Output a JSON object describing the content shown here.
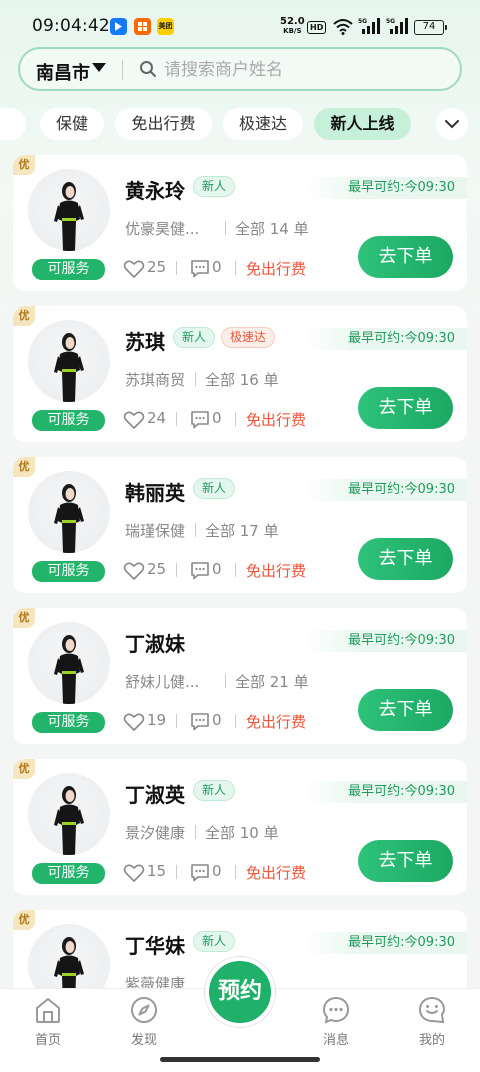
{
  "status_bar": {
    "time": "09:04:42",
    "app_icons": [
      "alipay-icon",
      "app-icon",
      "meituan-icon"
    ],
    "app_icon_texts": [
      "",
      "",
      "美团"
    ],
    "net_speed": "52.0",
    "net_unit": "KB/S",
    "hd": "HD",
    "battery": "74"
  },
  "search": {
    "city": "南昌市",
    "placeholder": "请搜索商户姓名"
  },
  "tabs": [
    {
      "label": "保健",
      "active": false
    },
    {
      "label": "免出行费",
      "active": false
    },
    {
      "label": "极速达",
      "active": false
    },
    {
      "label": "新人上线",
      "active": true
    }
  ],
  "card_common": {
    "badge": "优",
    "status": "可服务",
    "free_label": "免出行费",
    "order_button": "去下单"
  },
  "cards": [
    {
      "name": "黄永玲",
      "tags": [
        "新人"
      ],
      "earliest": "最早可约:今09:30",
      "shop": "优豪昊健...",
      "orders": "全部 14 单",
      "likes": "25",
      "messages": "0"
    },
    {
      "name": "苏琪",
      "tags": [
        "新人",
        "极速达"
      ],
      "earliest": "最早可约:今09:30",
      "shop": "苏琪商贸",
      "orders": "全部 16 单",
      "likes": "24",
      "messages": "0"
    },
    {
      "name": "韩丽英",
      "tags": [
        "新人"
      ],
      "earliest": "最早可约:今09:30",
      "shop": "瑞瑾保健",
      "orders": "全部 17 单",
      "likes": "25",
      "messages": "0"
    },
    {
      "name": "丁淑妹",
      "tags": [],
      "earliest": "最早可约:今09:30",
      "shop": "舒妹儿健...",
      "orders": "全部 21 单",
      "likes": "19",
      "messages": "0"
    },
    {
      "name": "丁淑英",
      "tags": [
        "新人"
      ],
      "earliest": "最早可约:今09:30",
      "shop": "景汐健康",
      "orders": "全部 10 单",
      "likes": "15",
      "messages": "0"
    },
    {
      "name": "丁华妹",
      "tags": [
        "新人"
      ],
      "earliest": "最早可约:今09:30",
      "shop": "紫薇健康",
      "orders": "",
      "likes": "",
      "messages": ""
    }
  ],
  "bottom_nav": {
    "items": [
      {
        "label": "首页",
        "icon": "home-icon"
      },
      {
        "label": "发现",
        "icon": "compass-icon"
      },
      {
        "label": "消息",
        "icon": "chat-icon"
      },
      {
        "label": "我的",
        "icon": "profile-icon"
      }
    ],
    "fab_label": "预约"
  },
  "colors": {
    "brand_green": "#1fb06a",
    "accent_red": "#f0553a",
    "tag_new": "#1f9c5d",
    "tag_fast": "#e2593a"
  }
}
